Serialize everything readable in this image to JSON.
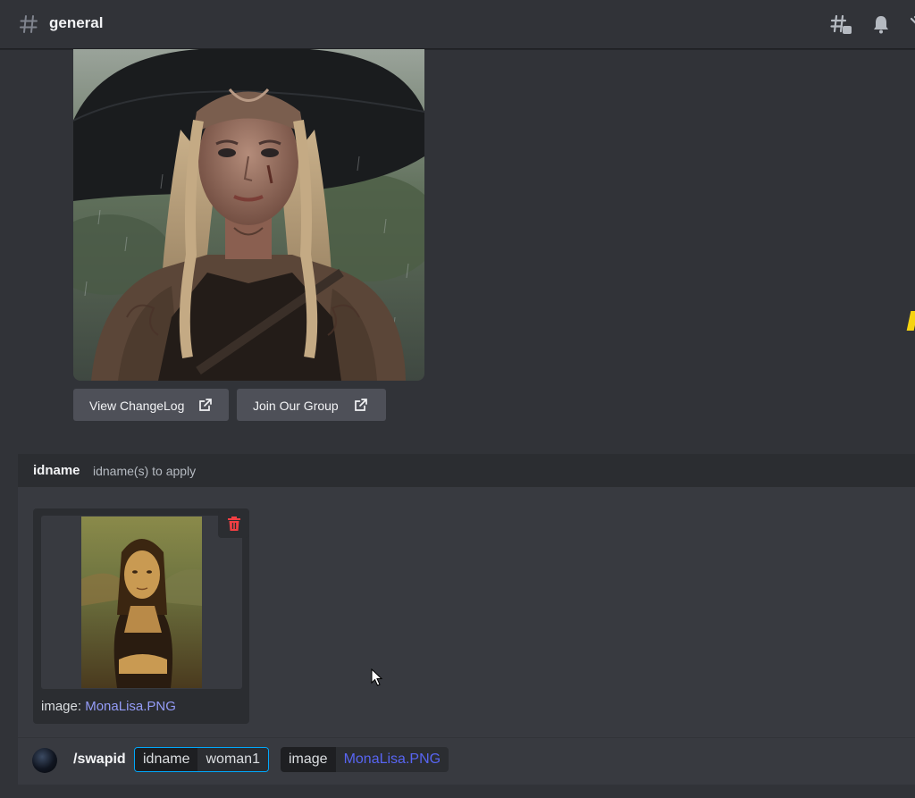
{
  "header": {
    "channel_name": "general",
    "icons": [
      "hashtag-icon",
      "threads-icon",
      "bell-icon",
      "pin-icon"
    ]
  },
  "embed": {
    "buttons": [
      {
        "label": "View ChangeLog",
        "icon": "external-link-icon"
      },
      {
        "label": "Join Our Group",
        "icon": "external-link-icon"
      }
    ]
  },
  "command_option": {
    "name": "idname",
    "description": "idname(s) to apply"
  },
  "attachment": {
    "caption_label": "image:",
    "filename": "MonaLisa.PNG",
    "delete_icon": "trash-icon"
  },
  "command": {
    "name": "/swapid",
    "options": [
      {
        "key": "idname",
        "value": "woman1"
      },
      {
        "key": "image",
        "value": "MonaLisa.PNG"
      }
    ]
  },
  "colors": {
    "background": "#313338",
    "link": "#949cf7",
    "active_border": "#00a8fc",
    "danger": "#f23f43",
    "accent_yellow": "#f5d311"
  }
}
